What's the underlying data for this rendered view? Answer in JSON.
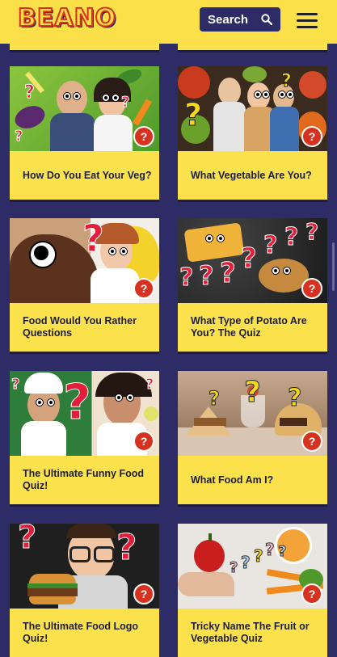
{
  "header": {
    "logo": "BEANO",
    "search_label": "Search"
  },
  "cards": [
    {
      "title": "How Do You Eat Your Veg?"
    },
    {
      "title": "What Vegetable Are You?"
    },
    {
      "title": "Food Would You Rather Questions"
    },
    {
      "title": "What Type of Potato Are You? The Quiz"
    },
    {
      "title": "The Ultimate Funny Food Quiz!"
    },
    {
      "title": "What Food Am I?"
    },
    {
      "title": "The Ultimate Food Logo Quiz!"
    },
    {
      "title": "Tricky Name The Fruit or Vegetable Quiz"
    }
  ],
  "quiz_badge": "?",
  "colors": {
    "header": "#fce04a",
    "background": "#2e2c66",
    "card_title_bg": "#fbe14c",
    "badge": "#d6321f"
  }
}
